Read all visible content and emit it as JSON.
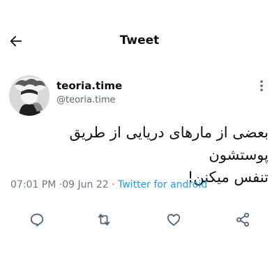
{
  "header": {
    "title": "Tweet",
    "back_icon": "arrow-left-icon"
  },
  "author": {
    "display_name": "teoria.time",
    "handle": "@teoria.time",
    "avatar_icon": "profile-avatar",
    "more_icon": "more-vertical-icon"
  },
  "tweet": {
    "text_line1": "بعضی از مارهای دریایی از طریق پوستشون",
    "text_line2": "تنفس میکنن!",
    "time": "07:01 PM",
    "separator": "·",
    "date": "09 Jun 22",
    "source": "Twitter for android"
  },
  "actions": {
    "reply_icon": "reply-icon",
    "retweet_icon": "retweet-icon",
    "like_icon": "heart-icon",
    "share_icon": "share-icon"
  },
  "colors": {
    "link": "#1d9bf0",
    "muted": "#6b7780",
    "icon": "#536471",
    "text": "#111111"
  }
}
